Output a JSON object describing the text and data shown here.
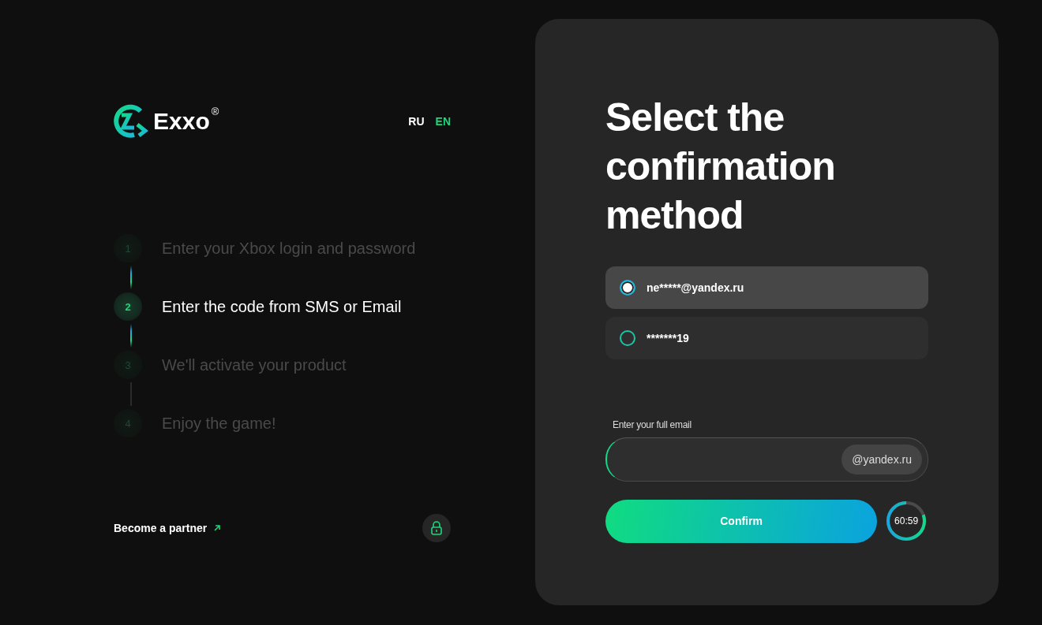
{
  "brand": {
    "name": "Exxo",
    "mark": "®"
  },
  "languages": [
    {
      "label": "RU",
      "selected": false
    },
    {
      "label": "EN",
      "selected": true
    }
  ],
  "steps": [
    {
      "number": "1",
      "label": "Enter your Xbox login and password",
      "selected": false
    },
    {
      "number": "2",
      "label": "Enter the code from SMS or Email",
      "selected": true
    },
    {
      "number": "3",
      "label": "We'll activate your product",
      "selected": false
    },
    {
      "number": "4",
      "label": "Enjoy the game!",
      "selected": false
    }
  ],
  "partner_link": "Become a partner",
  "form": {
    "title": "Select the confirmation method",
    "options": [
      {
        "label": "ne*****@yandex.ru",
        "selected": true
      },
      {
        "label": "*******19",
        "selected": false
      }
    ],
    "email_label": "Enter your full email",
    "email_suffix": "@yandex.ru",
    "confirm_button": "Confirm",
    "timer": {
      "text": "60:59"
    }
  }
}
